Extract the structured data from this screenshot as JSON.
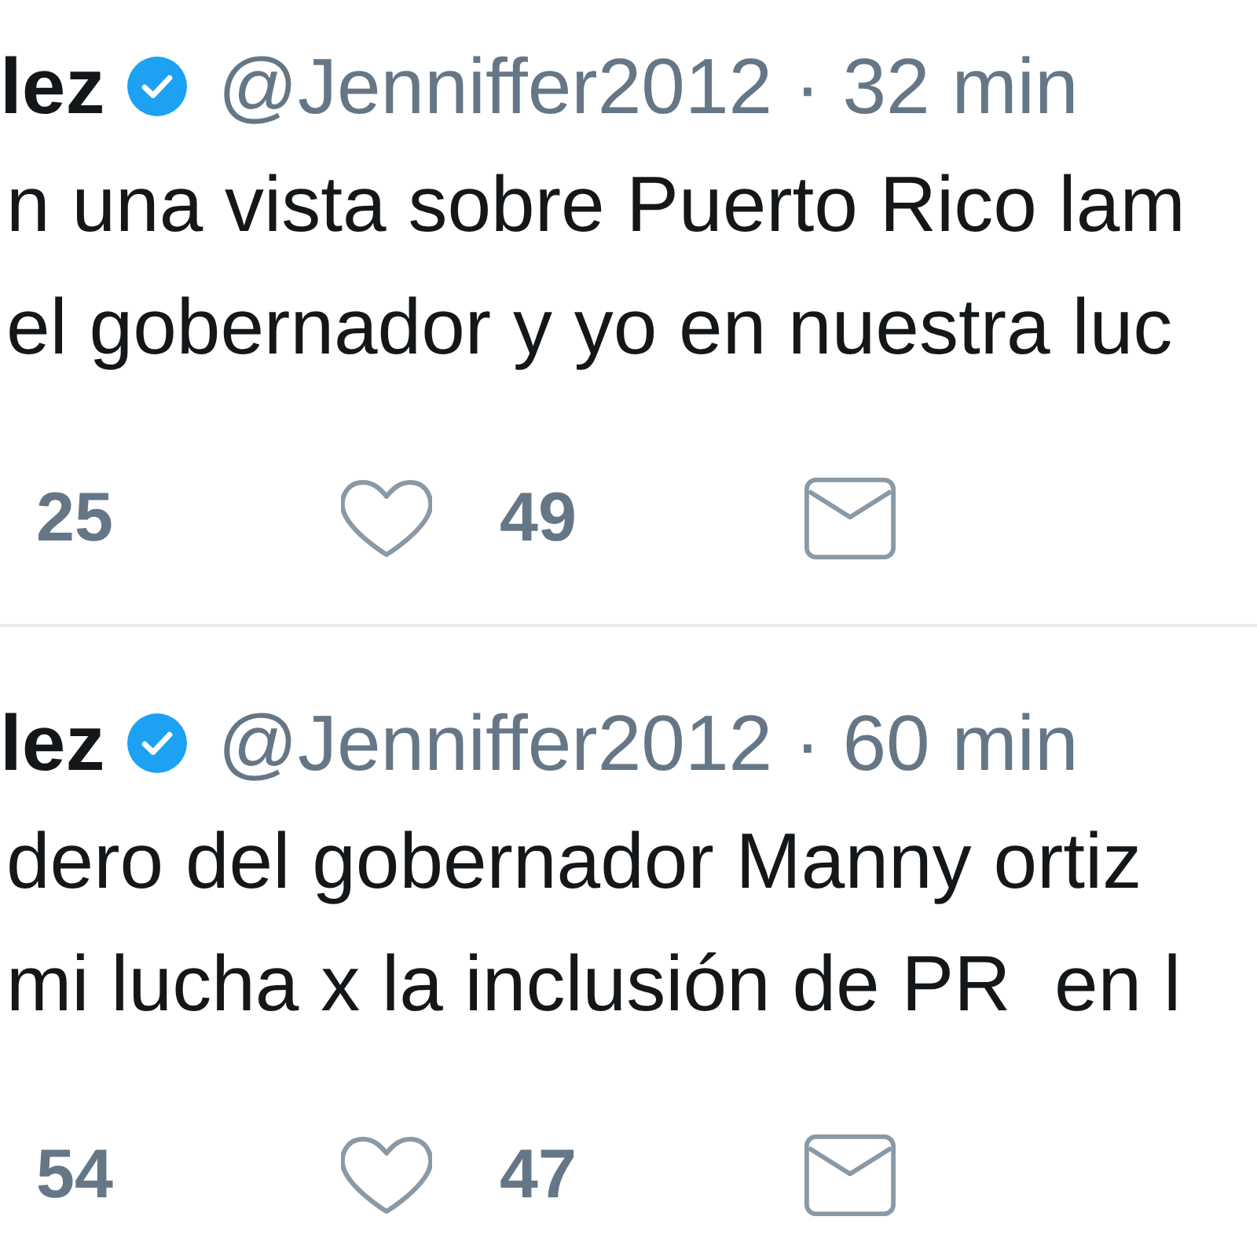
{
  "tweets": [
    {
      "author": "lez",
      "verified": true,
      "handle": "@Jenniffer2012",
      "separator": "·",
      "time": "32 min",
      "lines": [
        "n una vista sobre Puerto Rico lam",
        "el gobernador y yo en nuestra luc"
      ],
      "actions": [
        {
          "kind": "count",
          "count": "25"
        },
        {
          "kind": "like",
          "count": "49"
        },
        {
          "kind": "message"
        }
      ]
    },
    {
      "author": "lez",
      "verified": true,
      "handle": "@Jenniffer2012",
      "separator": "·",
      "time": "60 min",
      "lines": [
        "dero del gobernador Manny ortiz",
        "mi lucha x la inclusión de PR  en l"
      ],
      "actions": [
        {
          "kind": "count",
          "count": "54"
        },
        {
          "kind": "like",
          "count": "47"
        },
        {
          "kind": "message"
        }
      ]
    }
  ]
}
